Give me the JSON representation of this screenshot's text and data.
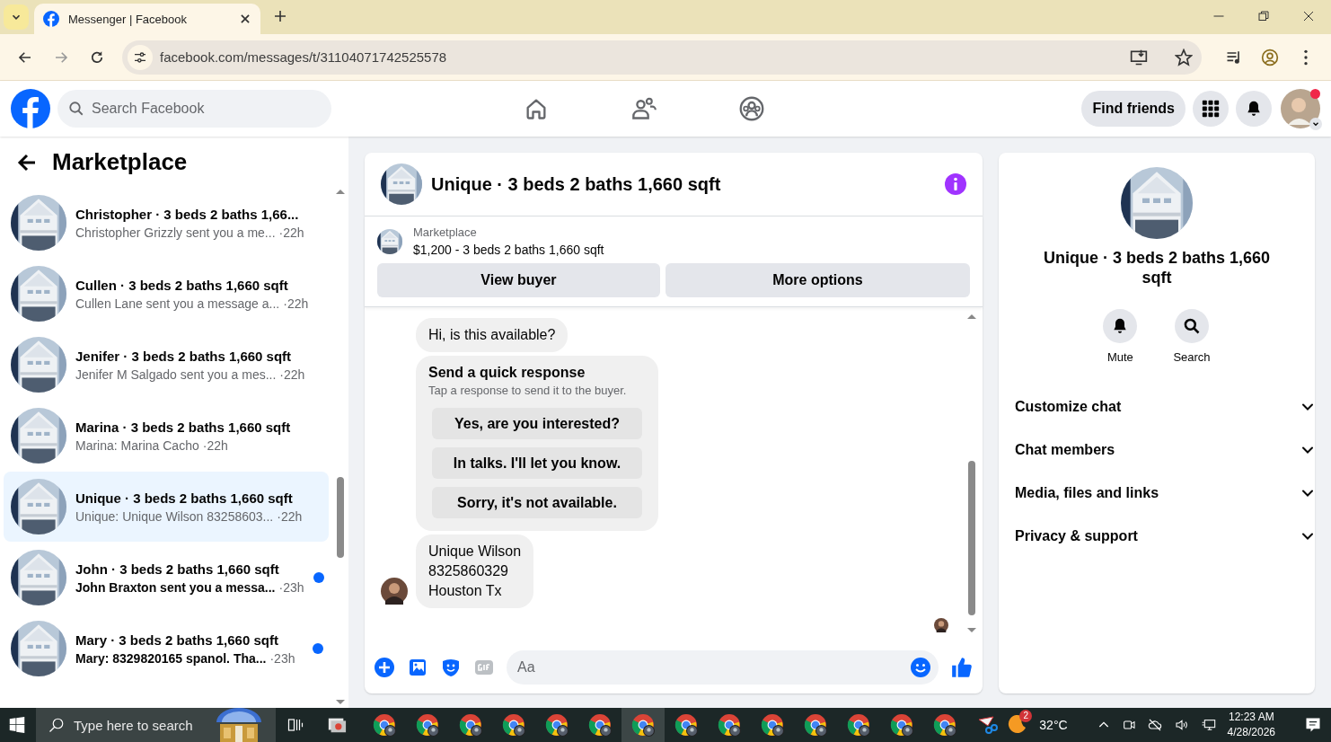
{
  "browser": {
    "tabs": [
      {
        "title": "Messenger | Facebook",
        "selected": true
      }
    ],
    "url": "facebook.com/messages/t/31104071742525578"
  },
  "header": {
    "search_placeholder": "Search Facebook",
    "find_friends": "Find friends"
  },
  "sidebar": {
    "title": "Marketplace",
    "conversations": [
      {
        "title": "Christopher · 3 beds 2 baths 1,66...",
        "preview": "Christopher Grizzly sent you a me...",
        "time": "·22h",
        "selected": false,
        "unread": false
      },
      {
        "title": "Cullen · 3 beds 2 baths 1,660 sqft",
        "preview": "Cullen Lane sent you a message a...",
        "time": "·22h",
        "selected": false,
        "unread": false
      },
      {
        "title": "Jenifer · 3 beds 2 baths 1,660 sqft",
        "preview": "Jenifer M Salgado sent you a mes...",
        "time": "·22h",
        "selected": false,
        "unread": false
      },
      {
        "title": "Marina · 3 beds 2 baths 1,660 sqft",
        "preview": "Marina: Marina Cacho",
        "time": "·22h",
        "selected": false,
        "unread": false
      },
      {
        "title": "Unique · 3 beds 2 baths 1,660 sqft",
        "preview": "Unique: Unique Wilson 83258603...",
        "time": "·22h",
        "selected": true,
        "unread": false
      },
      {
        "title": "John · 3 beds 2 baths 1,660 sqft",
        "preview": "John Braxton sent you a messa...",
        "time": "·23h",
        "selected": false,
        "unread": true
      },
      {
        "title": "Mary · 3 beds 2 baths 1,660 sqft",
        "preview": "Mary: 8329820165 spanol. Tha...",
        "time": "·23h",
        "selected": false,
        "unread": true
      }
    ]
  },
  "chat": {
    "title": "Unique · 3 beds 2 baths 1,660 sqft",
    "listing": {
      "label": "Marketplace",
      "detail": "$1,200 - 3 beds 2 baths 1,660 sqft"
    },
    "buttons": [
      "View buyer",
      "More options"
    ],
    "messages": [
      {
        "kind": "text",
        "text": "Hi, is this available?",
        "sender_avatar": false
      },
      {
        "kind": "quick_response",
        "title": "Send a quick response",
        "subtitle": "Tap a response to send it to the buyer.",
        "options": [
          "Yes, are you interested?",
          "In talks. I'll let you know.",
          "Sorry, it's not available."
        ]
      },
      {
        "kind": "text",
        "text": "Unique Wilson\n8325860329\nHouston Tx",
        "sender_avatar": true
      }
    ],
    "composer_placeholder": "Aa"
  },
  "details": {
    "title": "Unique · 3 beds 2 baths 1,660 sqft",
    "actions": [
      {
        "kind": "mute",
        "label": "Mute"
      },
      {
        "kind": "search",
        "label": "Search"
      }
    ],
    "sections": [
      "Customize chat",
      "Chat members",
      "Media, files and links",
      "Privacy & support"
    ]
  },
  "taskbar": {
    "search_placeholder": "Type here to search",
    "apps": [
      {
        "selected": false
      },
      {
        "selected": false
      },
      {
        "selected": false
      },
      {
        "selected": false
      },
      {
        "selected": false
      },
      {
        "selected": false
      },
      {
        "selected": true
      },
      {
        "selected": false
      },
      {
        "selected": false
      },
      {
        "selected": false
      },
      {
        "selected": false
      },
      {
        "selected": false
      },
      {
        "selected": false
      },
      {
        "selected": false
      }
    ],
    "weather_badge": "2",
    "temperature": "32°C",
    "time": "12:23 AM",
    "date": "4/28/2026"
  }
}
